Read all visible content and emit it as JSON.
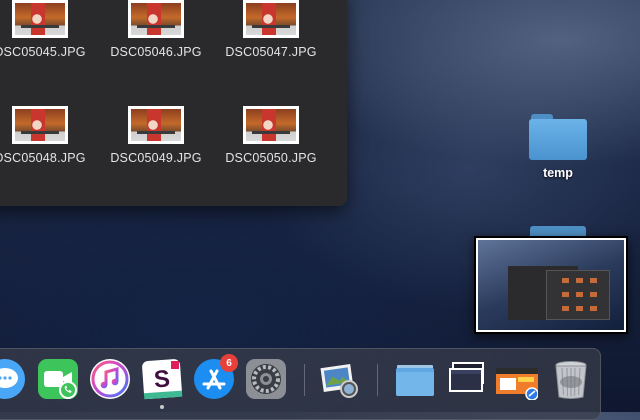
{
  "finder": {
    "files": [
      {
        "name": "DSC05045.JPG"
      },
      {
        "name": "DSC05046.JPG"
      },
      {
        "name": "DSC05047.JPG"
      },
      {
        "name": "DSC05048.JPG"
      },
      {
        "name": "DSC05049.JPG"
      },
      {
        "name": "DSC05050.JPG"
      }
    ]
  },
  "desktop": {
    "folder_label": "temp"
  },
  "dock": {
    "items": [
      {
        "icon": "messages-icon"
      },
      {
        "icon": "facetime-icon"
      },
      {
        "icon": "itunes-icon"
      },
      {
        "icon": "slack-icon"
      },
      {
        "icon": "app-store-icon",
        "badge": "6"
      },
      {
        "icon": "system-preferences-icon"
      },
      {
        "icon": "preview-icon"
      },
      {
        "icon": "folder-stack-icon"
      },
      {
        "icon": "window-stack-icon"
      },
      {
        "icon": "downloads-stack-icon"
      },
      {
        "icon": "trash-icon"
      }
    ]
  },
  "colors": {
    "folder_blue": "#4b93cf",
    "badge_red": "#e7403b",
    "finder_bg": "#2a2a2c"
  }
}
